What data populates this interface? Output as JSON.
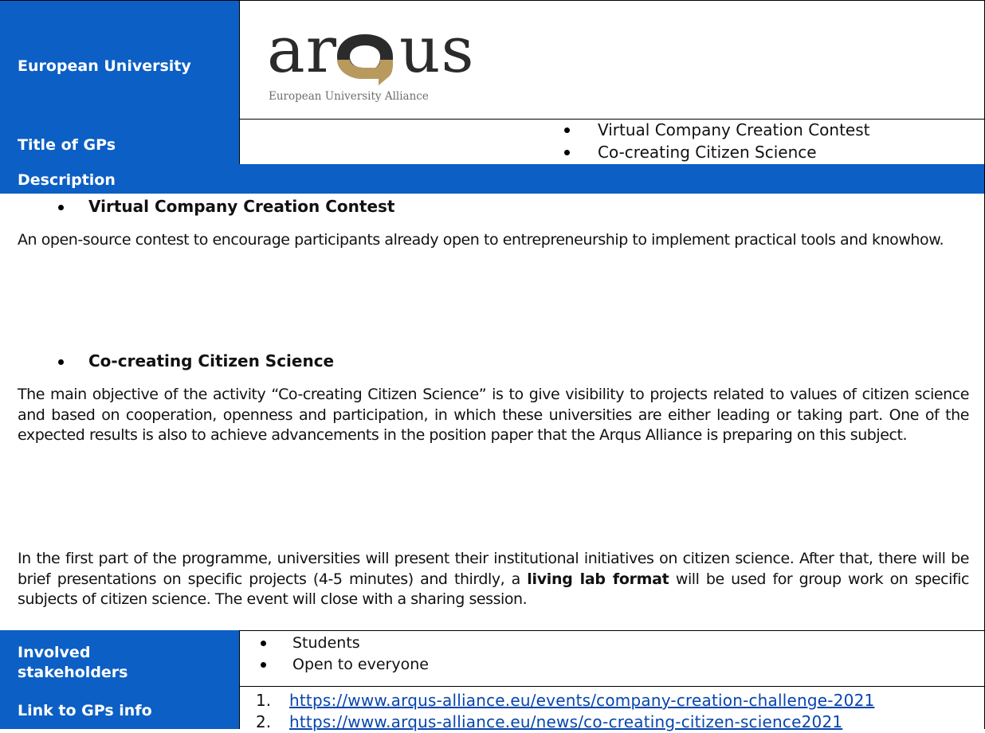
{
  "rows": {
    "european_university": {
      "label": "European University",
      "logo": {
        "word": "arQus",
        "word_left": "ar",
        "word_right": "us",
        "tagline": "European University Alliance",
        "colors": {
          "text": "#2b2b2b",
          "gold": "#b89a5e",
          "tagline": "#6d6d6d"
        }
      }
    },
    "title_of_gps": {
      "label": "Title of GPs",
      "items": [
        "Virtual Company Creation Contest",
        "Co-creating Citizen Science"
      ]
    },
    "description": {
      "label": "Description",
      "section1_title": "Virtual Company Creation Contest",
      "section1_text": "An open-source contest to encourage participants already open to entrepreneurship to implement practical tools and knowhow.",
      "section2_title": "Co-creating Citizen Science",
      "section2_text": "The main objective of the activity “Co-creating Citizen Science” is to give visibility to projects related to values of citizen science and based on cooperation, openness and participation, in which these universities are either leading or taking part. One of the expected results is also to achieve advancements in the position paper that the Arqus Alliance is preparing on this subject.",
      "section3_text_before": "In the first part of the programme, universities will present their institutional initiatives on citizen science. After that, there will be brief presentations on specific projects (4-5 minutes) and thirdly, a ",
      "section3_bold": "living lab format",
      "section3_text_after": " will be used for group work on specific subjects of citizen science. The event will close with a sharing session."
    },
    "involved_stakeholders": {
      "label": "Involved stakeholders",
      "items": [
        "Students",
        "Open to everyone"
      ]
    },
    "link_to_gps_info": {
      "label": "Link to GPs info",
      "links": [
        {
          "num": "1.",
          "url": "https://www.arqus-alliance.eu/events/company-creation-challenge-2021"
        },
        {
          "num": "2.",
          "url": "https://www.arqus-alliance.eu/news/co-creating-citizen-science2021"
        }
      ]
    }
  },
  "colors": {
    "header_blue": "#0c5fc4",
    "link": "#0645ad",
    "border": "#000000"
  }
}
